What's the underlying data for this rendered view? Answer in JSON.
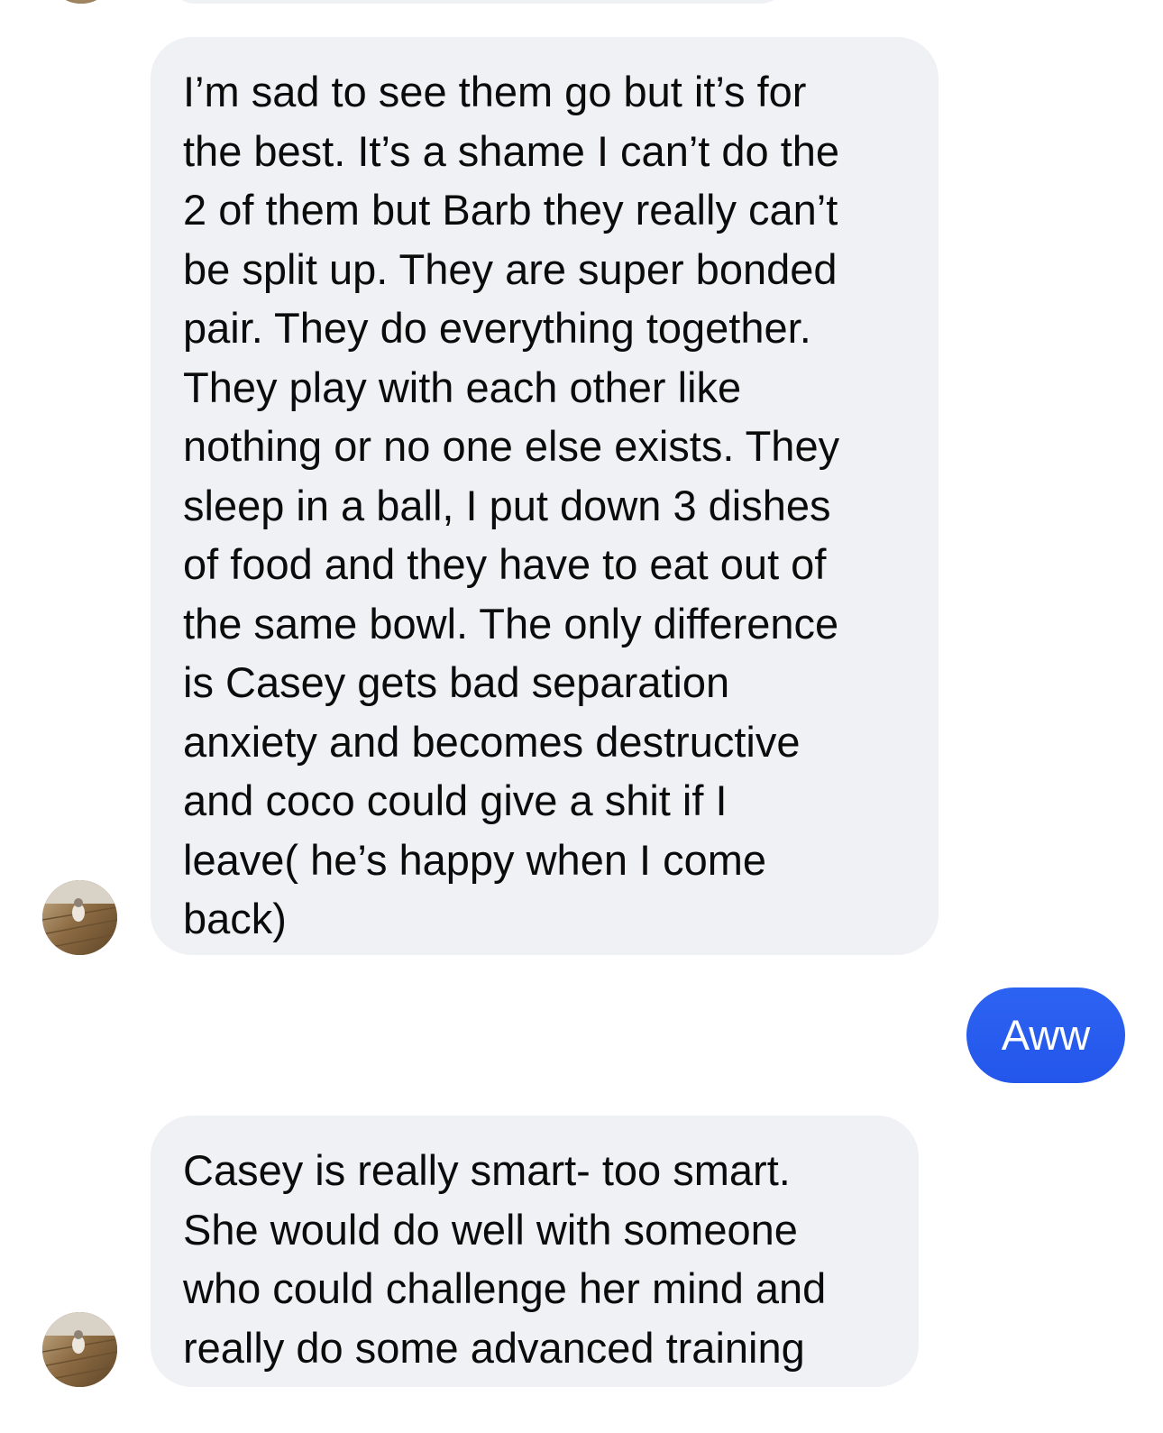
{
  "conversation": {
    "messages": [
      {
        "direction": "incoming",
        "text": "I’m sad to see them go but it’s for\nthe best. It’s a shame I can’t do the\n2 of them but Barb they really can’t\nbe split up. They are super bonded\npair. They do everything together.\nThey play with each other like\nnothing or no one else exists. They\nsleep in a ball, I put down 3 dishes\nof food and they have to eat out of\nthe same bowl. The only difference\nis  Casey gets bad separation\nanxiety and becomes destructive\nand coco could give a shit if I\nleave( he’s happy when I come\nback)"
      },
      {
        "direction": "outgoing",
        "text": "Aww"
      },
      {
        "direction": "incoming",
        "text": "Casey is really smart- too smart.\nShe would do well with someone\nwho could challenge her mind and\nreally do some advanced training"
      }
    ]
  },
  "colors": {
    "incoming_bubble": "#f0f1f5",
    "outgoing_bubble": "#2f5cf0",
    "incoming_text": "#0b0b0b",
    "outgoing_text": "#ffffff"
  },
  "icons": {
    "avatar": "contact-photo-avatar"
  }
}
